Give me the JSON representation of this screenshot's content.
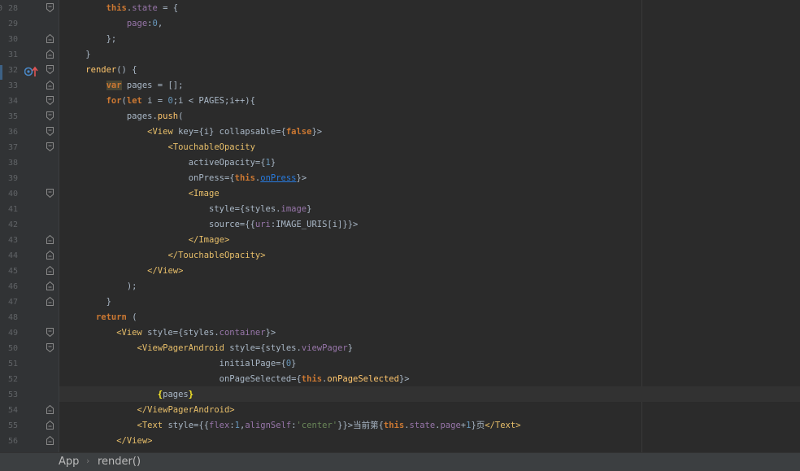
{
  "editor": {
    "first_line_partial": "0",
    "breadcrumbs": [
      "App",
      "render()"
    ],
    "breadcrumb_separator": "›",
    "lines": [
      {
        "n": "28",
        "tokens": [
          [
            "",
            "        "
          ],
          [
            "kw",
            "this"
          ],
          [
            "",
            ".",
            ""
          ],
          [
            "prop",
            "state"
          ],
          [
            "",
            " = {"
          ]
        ]
      },
      {
        "n": "29",
        "tokens": [
          [
            "",
            "            "
          ],
          [
            "prop",
            "page"
          ],
          [
            "",
            ":"
          ],
          [
            "num",
            "0"
          ],
          [
            "",
            ","
          ]
        ]
      },
      {
        "n": "30",
        "tokens": [
          [
            "",
            "        };"
          ]
        ]
      },
      {
        "n": "31",
        "tokens": [
          [
            "",
            "    }"
          ]
        ]
      },
      {
        "n": "32",
        "tokens": [
          [
            "",
            "    "
          ],
          [
            "fn",
            "render"
          ],
          [
            "",
            "() {"
          ]
        ]
      },
      {
        "n": "33",
        "tokens": [
          [
            "",
            "        "
          ],
          [
            "kwhl",
            "var"
          ],
          [
            "",
            " pages = [];"
          ]
        ]
      },
      {
        "n": "34",
        "tokens": [
          [
            "",
            "        "
          ],
          [
            "kw",
            "for"
          ],
          [
            "",
            "("
          ],
          [
            "kw",
            "let"
          ],
          [
            "",
            " i = "
          ],
          [
            "num",
            "0"
          ],
          [
            "",
            ";i < PAGES;i++){"
          ]
        ]
      },
      {
        "n": "35",
        "tokens": [
          [
            "",
            "            pages."
          ],
          [
            "fn",
            "push"
          ],
          [
            "",
            "("
          ]
        ]
      },
      {
        "n": "36",
        "tokens": [
          [
            "",
            "                "
          ],
          [
            "tag",
            "<View"
          ],
          [
            "",
            " key={i} collapsable={"
          ],
          [
            "kw",
            "false"
          ],
          [
            "",
            "}>"
          ]
        ]
      },
      {
        "n": "37",
        "tokens": [
          [
            "",
            "                    "
          ],
          [
            "tag",
            "<TouchableOpacity"
          ]
        ]
      },
      {
        "n": "38",
        "tokens": [
          [
            "",
            "                        activeOpacity={"
          ],
          [
            "num",
            "1"
          ],
          [
            "",
            "}"
          ]
        ]
      },
      {
        "n": "39",
        "tokens": [
          [
            "",
            "                        onPress={"
          ],
          [
            "kw",
            "this"
          ],
          [
            "",
            "."
          ],
          [
            "link",
            "onPress"
          ],
          [
            "",
            "}>"
          ]
        ]
      },
      {
        "n": "40",
        "tokens": [
          [
            "",
            "                        "
          ],
          [
            "tag",
            "<Image"
          ]
        ]
      },
      {
        "n": "41",
        "tokens": [
          [
            "",
            "                            style={styles."
          ],
          [
            "prop",
            "image"
          ],
          [
            "",
            "}"
          ]
        ]
      },
      {
        "n": "42",
        "tokens": [
          [
            "",
            "                            source={{"
          ],
          [
            "prop",
            "uri"
          ],
          [
            "",
            ":IMAGE_URIS[i]}}>"
          ]
        ]
      },
      {
        "n": "43",
        "tokens": [
          [
            "",
            "                        "
          ],
          [
            "tag",
            "</Image>"
          ]
        ]
      },
      {
        "n": "44",
        "tokens": [
          [
            "",
            "                    "
          ],
          [
            "tag",
            "</TouchableOpacity>"
          ]
        ]
      },
      {
        "n": "45",
        "tokens": [
          [
            "",
            "                "
          ],
          [
            "tag",
            "</View>"
          ]
        ]
      },
      {
        "n": "46",
        "tokens": [
          [
            "",
            "            );"
          ]
        ]
      },
      {
        "n": "47",
        "tokens": [
          [
            "",
            "        }"
          ]
        ]
      },
      {
        "n": "48",
        "tokens": [
          [
            "",
            "      "
          ],
          [
            "kw",
            "return"
          ],
          [
            "",
            " ("
          ]
        ]
      },
      {
        "n": "49",
        "tokens": [
          [
            "",
            "          "
          ],
          [
            "tag",
            "<View"
          ],
          [
            "",
            " style={styles."
          ],
          [
            "prop",
            "container"
          ],
          [
            "",
            "}>"
          ]
        ]
      },
      {
        "n": "50",
        "tokens": [
          [
            "",
            "              "
          ],
          [
            "tag",
            "<ViewPagerAndroid"
          ],
          [
            "",
            " style={styles."
          ],
          [
            "prop",
            "viewPager"
          ],
          [
            "",
            "}"
          ]
        ]
      },
      {
        "n": "51",
        "tokens": [
          [
            "",
            "                              initialPage={"
          ],
          [
            "num",
            "0"
          ],
          [
            "",
            "}"
          ]
        ]
      },
      {
        "n": "52",
        "tokens": [
          [
            "",
            "                              onPageSelected={"
          ],
          [
            "kw",
            "this"
          ],
          [
            "",
            "."
          ],
          [
            "fn",
            "onPageSelected"
          ],
          [
            "",
            "}>"
          ]
        ]
      },
      {
        "n": "53",
        "tokens": [
          [
            "",
            "                  "
          ],
          [
            "bhl",
            "{"
          ],
          [
            "",
            "pages"
          ],
          [
            "bhl",
            "}"
          ]
        ]
      },
      {
        "n": "54",
        "tokens": [
          [
            "",
            "              "
          ],
          [
            "tag",
            "</ViewPagerAndroid>"
          ]
        ]
      },
      {
        "n": "55",
        "tokens": [
          [
            "",
            "              "
          ],
          [
            "tag",
            "<Text"
          ],
          [
            "",
            " style={{"
          ],
          [
            "prop",
            "flex"
          ],
          [
            "",
            ":"
          ],
          [
            "num",
            "1"
          ],
          [
            "",
            ","
          ],
          [
            "prop",
            "alignSelf"
          ],
          [
            "",
            ":"
          ],
          [
            "str",
            "'center'"
          ],
          [
            "",
            "}}>当前第{"
          ],
          [
            "kw",
            "this"
          ],
          [
            "",
            "."
          ],
          [
            "prop",
            "state"
          ],
          [
            "",
            "."
          ],
          [
            "prop",
            "page"
          ],
          [
            "",
            "+"
          ],
          [
            "num",
            "1"
          ],
          [
            "",
            "}页"
          ],
          [
            "tag",
            "</Text>"
          ]
        ]
      },
      {
        "n": "56",
        "tokens": [
          [
            "",
            "          "
          ],
          [
            "tag",
            "</View>"
          ]
        ]
      }
    ],
    "folds": {
      "28": "open",
      "30": "close",
      "31": "close",
      "32": "open",
      "33": "close",
      "34": "open",
      "35": "open",
      "36": "open",
      "37": "open",
      "40": "open",
      "43": "close",
      "44": "close",
      "45": "close",
      "46": "close",
      "47": "close",
      "49": "open",
      "50": "open",
      "54": "close",
      "55": "close",
      "56": "close"
    },
    "colors": {
      "background": "#2b2b2b",
      "gutter": "#313335",
      "keyword": "#cc7832",
      "property": "#9876aa",
      "number": "#6897bb",
      "string": "#6a8759",
      "tag": "#e8bf6a",
      "function": "#ffc66d"
    }
  }
}
